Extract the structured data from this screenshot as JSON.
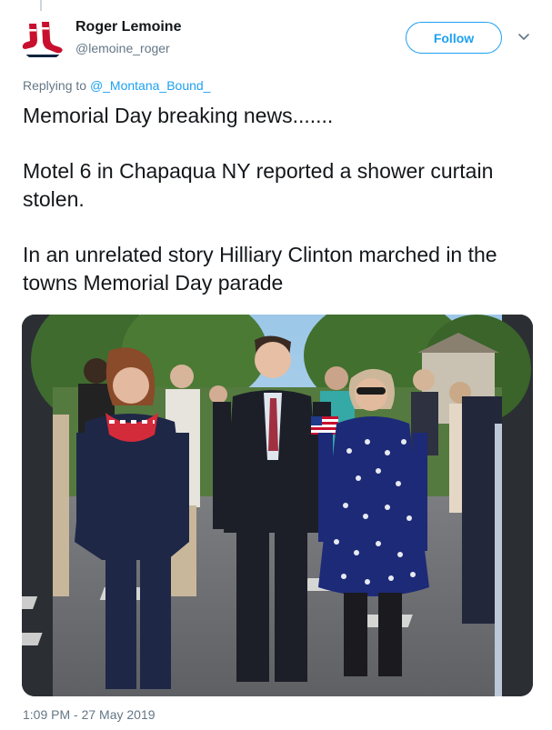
{
  "author": {
    "name": "Roger Lemoine",
    "handle": "@lemoine_roger",
    "avatar_icon": "red-sox-logo-icon"
  },
  "follow_label": "Follow",
  "menu_icon": "chevron-down-icon",
  "reply": {
    "prefix": "Replying to ",
    "mention": "@_Montana_Bound_"
  },
  "tweet": {
    "line1": "Memorial Day breaking news.......",
    "line2": "Motel 6 in Chapaqua NY reported a shower curtain stolen.",
    "line3": "In an unrelated story Hilliary Clinton marched in the towns Memorial Day parade"
  },
  "media": {
    "type": "photo",
    "scene": "people-marching-in-parade-photo"
  },
  "timestamp": "1:09 PM - 27 May 2019",
  "colors": {
    "accent": "#1da1f2",
    "secondary_text": "#657786",
    "primary_text": "#14171a"
  }
}
